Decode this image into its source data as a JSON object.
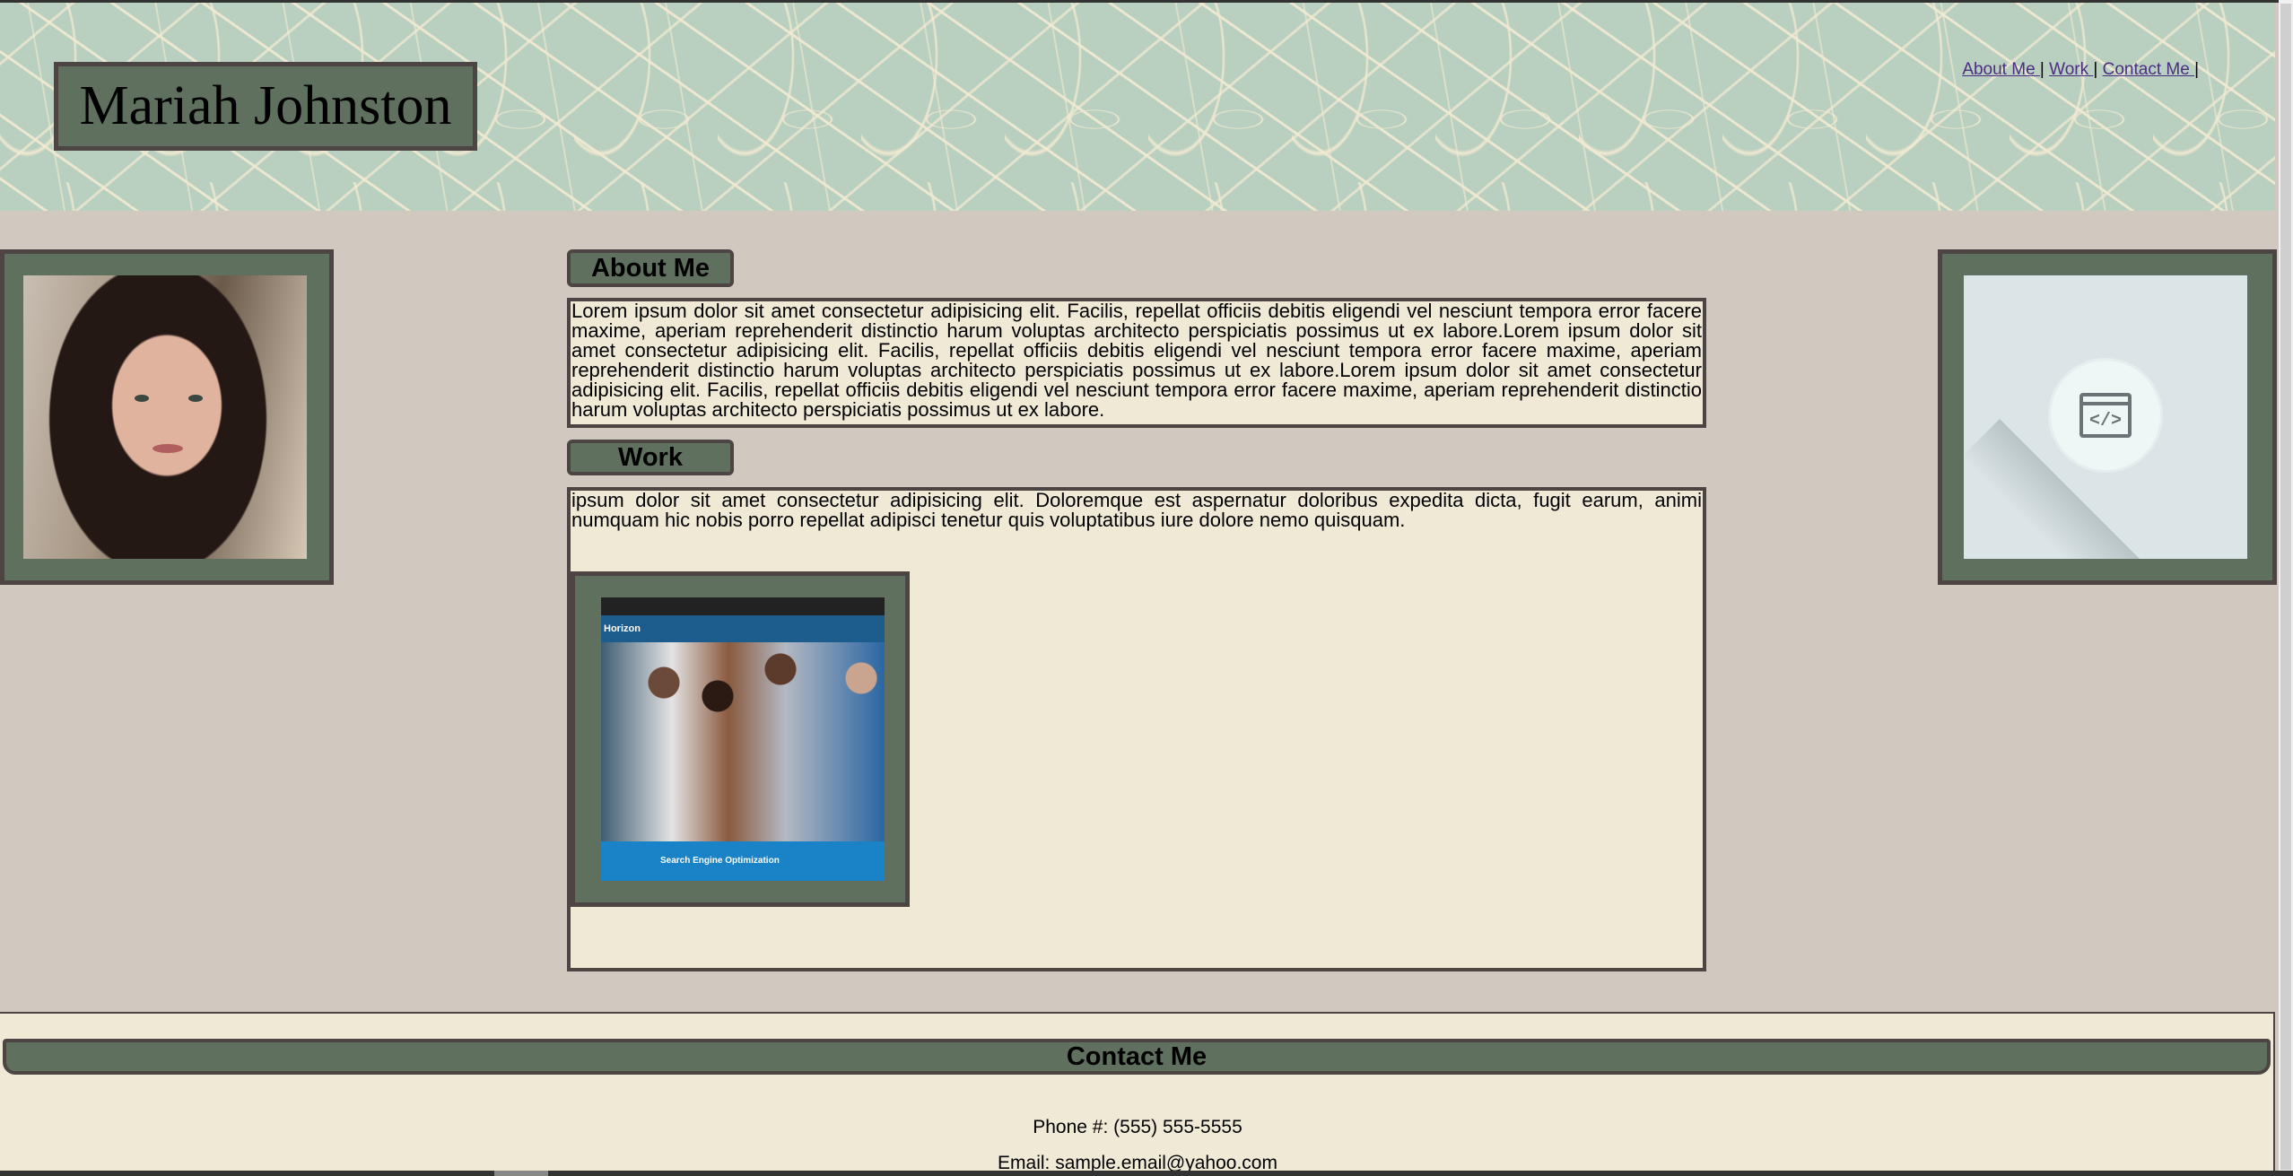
{
  "header": {
    "name": "Mariah Johnston",
    "nav": [
      {
        "label": "About Me "
      },
      {
        "label": "Work "
      },
      {
        "label": "Contact Me "
      }
    ],
    "nav_separator": "|"
  },
  "about": {
    "heading": "About Me",
    "text": "Lorem ipsum dolor sit amet consectetur adipisicing elit. Facilis, repellat officiis debitis eligendi vel nesciunt tempora error facere maxime, aperiam reprehenderit distinctio harum voluptas architecto perspiciatis possimus ut ex labore.Lorem ipsum dolor sit amet consectetur adipisicing elit. Facilis, repellat officiis debitis eligendi vel nesciunt tempora error facere maxime, aperiam reprehenderit distinctio harum voluptas architecto perspiciatis possimus ut ex labore.Lorem ipsum dolor sit amet consectetur adipisicing elit. Facilis, repellat officiis debitis eligendi vel nesciunt tempora error facere maxime, aperiam reprehenderit distinctio harum voluptas architecto perspiciatis possimus ut ex labore."
  },
  "work": {
    "heading": "Work",
    "text": "ipsum dolor sit amet consectetur adipisicing elit. Doloremque est aspernatur doloribus expedita dicta, fugit earum, animi numquam hic nobis porro repellat adipisci tenetur quis voluptatibus iure dolore nemo quisquam.",
    "project_brand": "Horizon",
    "project_banner": "Search Engine Optimization"
  },
  "side": {
    "code_symbol": "</>"
  },
  "contact": {
    "heading": "Contact Me",
    "phone": "Phone #: (555) 555-5555",
    "email": "Email: sample.email@yahoo.com"
  },
  "colors": {
    "background": "#d1c9bf",
    "frame_green": "#5f705f",
    "border": "#4d4444",
    "panel": "#f0e9d6",
    "link": "#4b2e83",
    "hero_leaf_bg": "#b9cfbf"
  }
}
